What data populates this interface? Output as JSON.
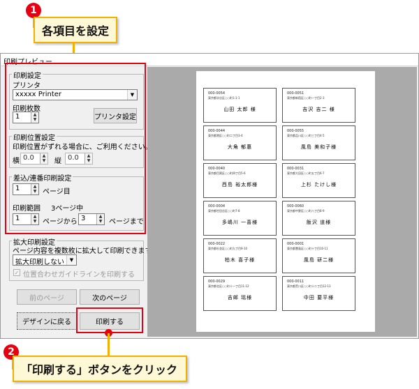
{
  "callouts": {
    "step1_number": "1",
    "step1_text": "各項目を設定",
    "step2_number": "2",
    "step2_text": "「印刷する」ボタンをクリック"
  },
  "window": {
    "title": "印刷プレビュー"
  },
  "print_settings": {
    "group_title": "印刷設定",
    "printer_label": "プリンタ",
    "printer_value": "xxxxx Printer",
    "copies_label": "印刷枚数",
    "copies_value": "1",
    "printer_settings_button": "プリンタ設定"
  },
  "position_settings": {
    "group_title": "印刷位置設定",
    "note": "印刷位置がずれる場合に、ご利用ください。",
    "horizontal_label": "横",
    "horizontal_value": "0.0",
    "vertical_label": "縦",
    "vertical_value": "0.0"
  },
  "insert_settings": {
    "group_title": "差込/連番印刷設定",
    "start_page_value": "1",
    "start_page_suffix": "ページ目",
    "range_label": "印刷範囲",
    "range_info": "3ページ中",
    "range_from_value": "1",
    "range_from_suffix": "ページから",
    "range_to_value": "3",
    "range_to_suffix": "ページまで"
  },
  "enlarge_settings": {
    "group_title": "拡大印刷設定",
    "note": "ページ内容を複数枚に拡大して印刷できます。",
    "select_value": "拡大印刷しない",
    "guide_checkbox_label": "位置合わせガイドラインを印刷する"
  },
  "buttons": {
    "prev_page": "前のページ",
    "next_page": "次のページ",
    "back_to_design": "デザインに戻る",
    "print": "印刷する"
  },
  "labels": [
    {
      "zip": "000-0054",
      "addr": "東京都渋谷区○○町1-1-1",
      "name": "山田 太郎 様"
    },
    {
      "zip": "000-0051",
      "addr": "東京都新宿区○○町一丁目2-3",
      "name": "吉沢 吉二 様"
    },
    {
      "zip": "000-0044",
      "addr": "東京都港区○○町二丁目3-4",
      "name": "大角 郁惠"
    },
    {
      "zip": "000-0055",
      "addr": "東京都品川区○○町三丁目4-5",
      "name": "風島 美和子様"
    },
    {
      "zip": "000-0040",
      "addr": "東京都目黒区○○町四丁目5-6",
      "name": "西島 裕太郎様"
    },
    {
      "zip": "000-0031",
      "addr": "東京都大田区○○町五丁目6-7",
      "name": "上杉 たけし様"
    },
    {
      "zip": "000-0004",
      "addr": "東京都世田谷区○○町7-8",
      "name": "多嶋川 一喜様"
    },
    {
      "zip": "000-0060",
      "addr": "東京都中野区○○町八丁目8-9",
      "name": "飯沢 道様"
    },
    {
      "zip": "000-0022",
      "addr": "東京都杉並区○○町九丁目9-10",
      "name": "柏木 喜子様"
    },
    {
      "zip": "000-0001",
      "addr": "東京都豊島区○○町十丁目10-11",
      "name": "風島 研二様"
    },
    {
      "zip": "000-0029",
      "addr": "東京都北区○○町十一丁目11-12",
      "name": "吉邮 瑶様"
    },
    {
      "zip": "000-0011",
      "addr": "東京都荒川区○○町十二丁目12-13",
      "name": "中田 要平様"
    }
  ]
}
